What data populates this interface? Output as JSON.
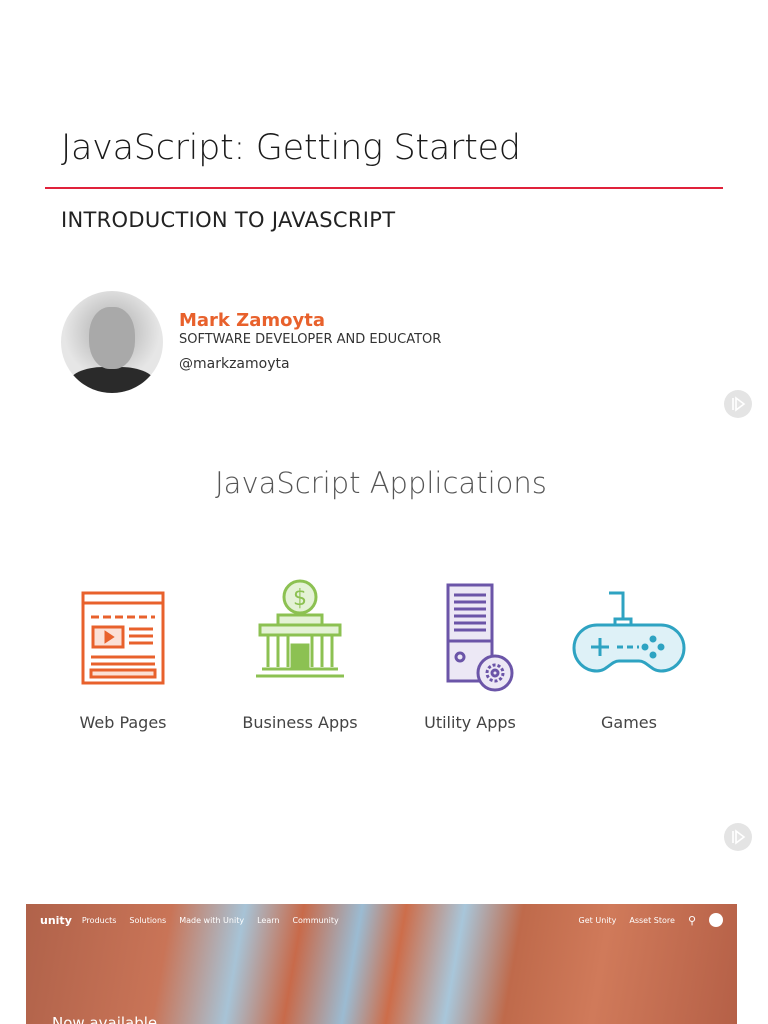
{
  "slide1": {
    "title": "JavaScript: Getting Started",
    "module": "INTRODUCTION TO JAVASCRIPT",
    "author": {
      "name": "Mark Zamoyta",
      "role": "SOFTWARE DEVELOPER AND EDUCATOR",
      "handle": "@markzamoyta"
    }
  },
  "slide2": {
    "title": "JavaScript Applications",
    "apps": [
      {
        "label": "Web Pages",
        "color": "#e8612c"
      },
      {
        "label": "Business Apps",
        "color": "#8cc152"
      },
      {
        "label": "Utility Apps",
        "color": "#6b55a8"
      },
      {
        "label": "Games",
        "color": "#2ea3c2"
      }
    ]
  },
  "banner": {
    "logo": "unity",
    "nav": [
      "Products",
      "Solutions",
      "Made with Unity",
      "Learn",
      "Community"
    ],
    "right": [
      "Get Unity",
      "Asset Store"
    ],
    "headline": "Now available"
  },
  "colors": {
    "accent": "#e0223b",
    "author": "#e8612c"
  }
}
